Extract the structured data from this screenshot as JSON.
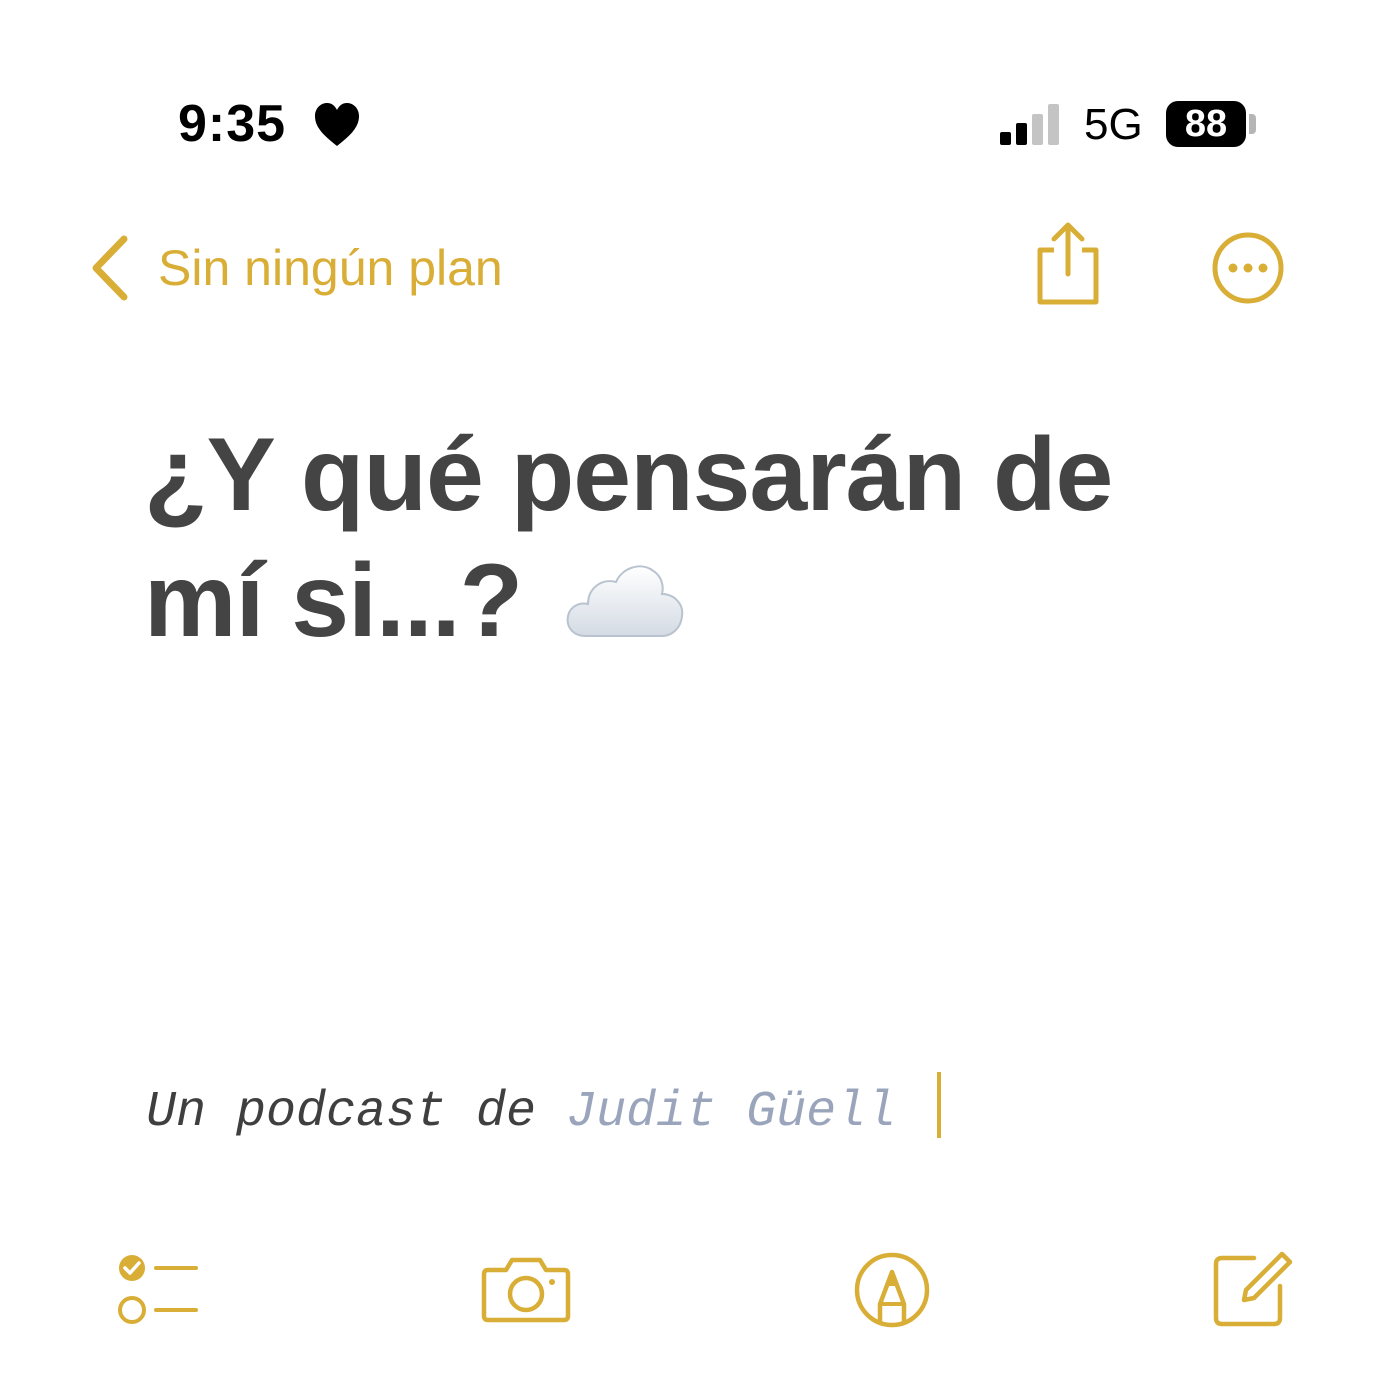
{
  "status_bar": {
    "time": "9:35",
    "network": "5G",
    "battery_level": "88",
    "signal_bars_active": 2,
    "signal_bars_total": 4
  },
  "nav": {
    "back_label": "Sin ningún plan"
  },
  "note": {
    "title_line1": "¿Y qué pensarán de",
    "title_line2": "mí si...?",
    "subtitle_prefix": "Un podcast de ",
    "subtitle_author": "Judit Güell"
  },
  "icons": {
    "status_heart": "heart-icon",
    "signal": "cellular-signal-icon",
    "back": "chevron-left-icon",
    "share": "share-icon",
    "more": "ellipsis-circle-icon",
    "cloud": "cloud-emoji-icon",
    "checklist": "checklist-icon",
    "camera": "camera-icon",
    "markup": "markup-pen-icon",
    "compose": "compose-icon"
  },
  "colors": {
    "accent": "#D9AE36",
    "title_text": "#444444",
    "author_text": "#9aa5bc",
    "background": "#ffffff"
  }
}
